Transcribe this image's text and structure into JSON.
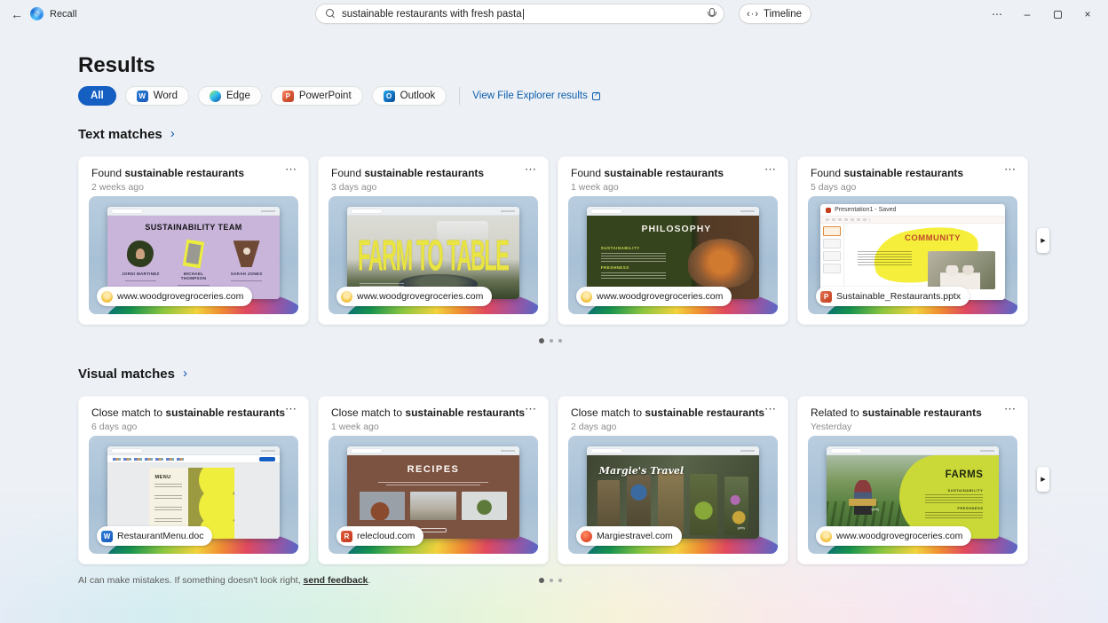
{
  "header": {
    "app_name": "Recall",
    "search": {
      "value": "sustainable restaurants with fresh pasta"
    },
    "timeline_label": "Timeline"
  },
  "glyphs": {
    "back": "←",
    "timeline": "‹·›",
    "more": "⋯",
    "minimize": "–",
    "close": "×",
    "chevron_right": "›",
    "card_menu": "⋯",
    "next_arrow": "▶"
  },
  "colors": {
    "accent": "#155fc2",
    "link": "#0b5cab",
    "selected_pill": "#155fc2"
  },
  "page": {
    "title": "Results"
  },
  "filters": {
    "items": [
      {
        "label": "All",
        "icon": "all",
        "selected": true
      },
      {
        "label": "Word",
        "icon": "word-logo",
        "selected": false
      },
      {
        "label": "Edge",
        "icon": "edge-logo",
        "selected": false
      },
      {
        "label": "PowerPoint",
        "icon": "powerpoint-logo",
        "selected": false
      },
      {
        "label": "Outlook",
        "icon": "outlook-logo",
        "selected": false
      }
    ],
    "word_initial": "W",
    "powerpoint_initial": "P",
    "outlook_initial": "O",
    "file_explorer_link": "View File Explorer results"
  },
  "sections": {
    "text_matches": {
      "title": "Text matches",
      "cards": [
        {
          "title_prefix": "Found",
          "title_highlight": "sustainable restaurants",
          "time": "2 weeks ago",
          "badge": {
            "icon": "woodgrove-favicon",
            "label": "www.woodgrovegroceries.com"
          },
          "thumb": {
            "title": "SUSTAINABILITY TEAM",
            "names": [
              "JORDI MARTINEZ",
              "MICHAEL THOMPSON",
              "SARAH JONES"
            ]
          }
        },
        {
          "title_prefix": "Found",
          "title_highlight": "sustainable restaurants",
          "time": "3 days ago",
          "badge": {
            "icon": "woodgrove-favicon",
            "label": "www.woodgrovegroceries.com"
          },
          "thumb": {
            "title": "FARM TO TABLE"
          }
        },
        {
          "title_prefix": "Found",
          "title_highlight": "sustainable restaurants",
          "time": "1 week ago",
          "badge": {
            "icon": "woodgrove-favicon",
            "label": "www.woodgrovegroceries.com"
          },
          "thumb": {
            "title": "PHILOSOPHY",
            "headings": [
              "SUSTAINABILITY",
              "FRESHNESS"
            ]
          }
        },
        {
          "title_prefix": "Found",
          "title_highlight": "sustainable restaurants",
          "time": "5 days ago",
          "badge": {
            "icon": "powerpoint-favicon",
            "label": "Sustainable_Restaurants.pptx",
            "initial": "P"
          },
          "thumb": {
            "app_title": "Presentation1 - Saved",
            "title": "COMMUNITY"
          }
        }
      ]
    },
    "visual_matches": {
      "title": "Visual matches",
      "cards": [
        {
          "title_prefix": "Close match to",
          "title_highlight": "sustainable restaurants",
          "time": "6 days ago",
          "badge": {
            "icon": "word-favicon",
            "label": "RestaurantMenu.doc",
            "initial": "W"
          },
          "thumb": {
            "title": "MENU"
          }
        },
        {
          "title_prefix": "Close match to",
          "title_highlight": "sustainable restaurants",
          "time": "1 week ago",
          "badge": {
            "icon": "relecloud-favicon",
            "label": "relecloud.com",
            "initial": "R"
          },
          "thumb": {
            "title": "RECIPES"
          }
        },
        {
          "title_prefix": "Close match to",
          "title_highlight": "sustainable restaurants",
          "time": "2 days ago",
          "badge": {
            "icon": "margiestravel-favicon",
            "label": "Margiestravel.com"
          },
          "thumb": {
            "title": "Margie's Travel",
            "watermark": "getty"
          }
        },
        {
          "title_prefix": "Related to",
          "title_highlight": "sustainable restaurants",
          "time": "Yesterday",
          "badge": {
            "icon": "woodgrove-favicon",
            "label": "www.woodgrovegroceries.com"
          },
          "thumb": {
            "title": "FARMS",
            "headings": [
              "SUSTAINABILITY",
              "FRESHNESS"
            ],
            "watermark": "getty"
          }
        }
      ]
    }
  },
  "footer": {
    "disclaimer": "AI can make mistakes. If something doesn't look right,",
    "feedback_link": "send feedback",
    "period": "."
  }
}
